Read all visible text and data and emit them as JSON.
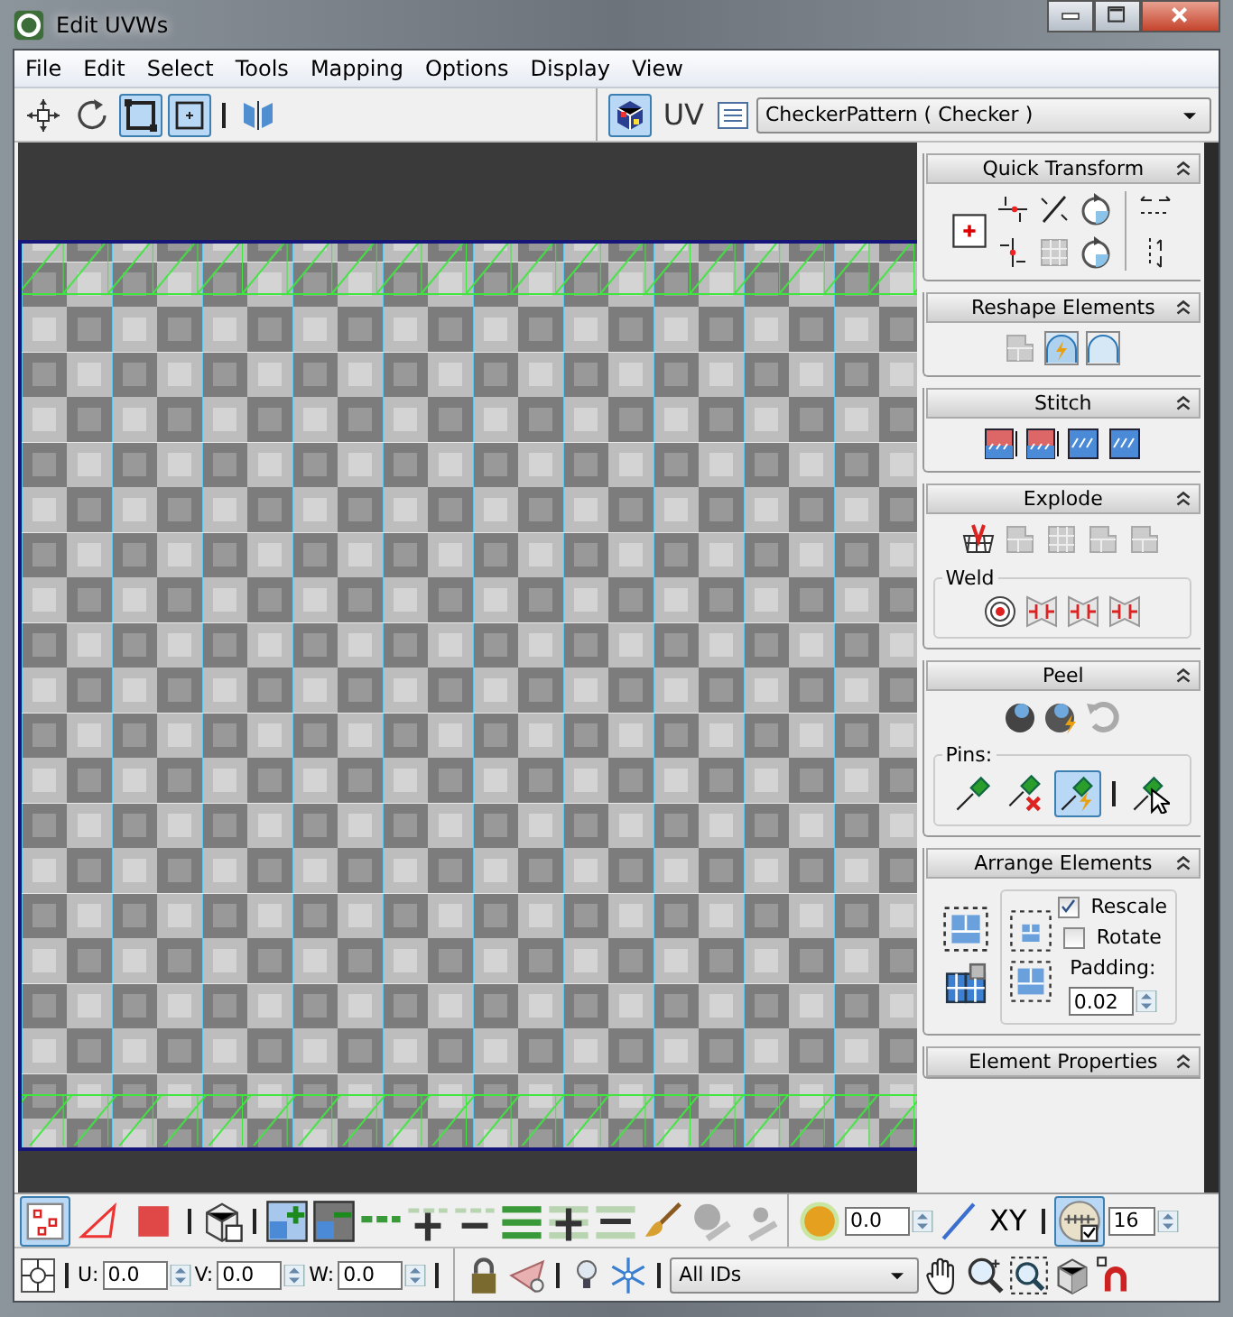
{
  "window": {
    "title": "Edit UVWs"
  },
  "menu": [
    {
      "label": "File"
    },
    {
      "label": "Edit"
    },
    {
      "label": "Select"
    },
    {
      "label": "Tools"
    },
    {
      "label": "Mapping"
    },
    {
      "label": "Options"
    },
    {
      "label": "Display"
    },
    {
      "label": "View"
    }
  ],
  "toolbar": {
    "tools": [
      {
        "selected": false
      },
      {
        "selected": false
      },
      {
        "selected": true
      },
      {
        "selected": true
      },
      {
        "selected": false
      }
    ],
    "checker_toggle": {
      "on": true
    },
    "uv_label": "UV",
    "texture": {
      "value": "CheckerPattern ( Checker )"
    }
  },
  "rollouts": [
    {
      "kind": "quick",
      "title": "Quick Transform",
      "expanded": true
    },
    {
      "kind": "reshape",
      "title": "Reshape Elements",
      "expanded": true
    },
    {
      "kind": "stitch",
      "title": "Stitch",
      "expanded": true
    },
    {
      "kind": "explode",
      "title": "Explode",
      "expanded": true,
      "group": "Weld"
    },
    {
      "kind": "peel",
      "title": "Peel",
      "expanded": true,
      "group": "Pins:",
      "pins": [
        {
          "selected": false
        },
        {
          "selected": false
        },
        {
          "selected": true
        },
        {
          "selected": false
        }
      ]
    },
    {
      "kind": "arrange",
      "title": "Arrange Elements",
      "expanded": true,
      "options": [
        {
          "label": "Rescale",
          "checked": true
        },
        {
          "label": "Rotate",
          "checked": false
        }
      ],
      "padding": {
        "label": "Padding:",
        "value": "0.02"
      }
    },
    {
      "kind": "properties",
      "title": "Element Properties",
      "expanded": true
    }
  ],
  "bottom": {
    "modes": [
      {
        "selected": true
      },
      {
        "selected": false
      },
      {
        "selected": false
      }
    ],
    "soft_select": {
      "value": "0.0"
    },
    "axis_label": "XY",
    "grid_snap": {
      "on": true
    },
    "grid_size": {
      "value": "16"
    },
    "coords": [
      {
        "label": "U:",
        "value": "0.0"
      },
      {
        "label": "V:",
        "value": "0.0"
      },
      {
        "label": "W:",
        "value": "0.0"
      }
    ],
    "id_filter": {
      "value": "All IDs"
    }
  }
}
